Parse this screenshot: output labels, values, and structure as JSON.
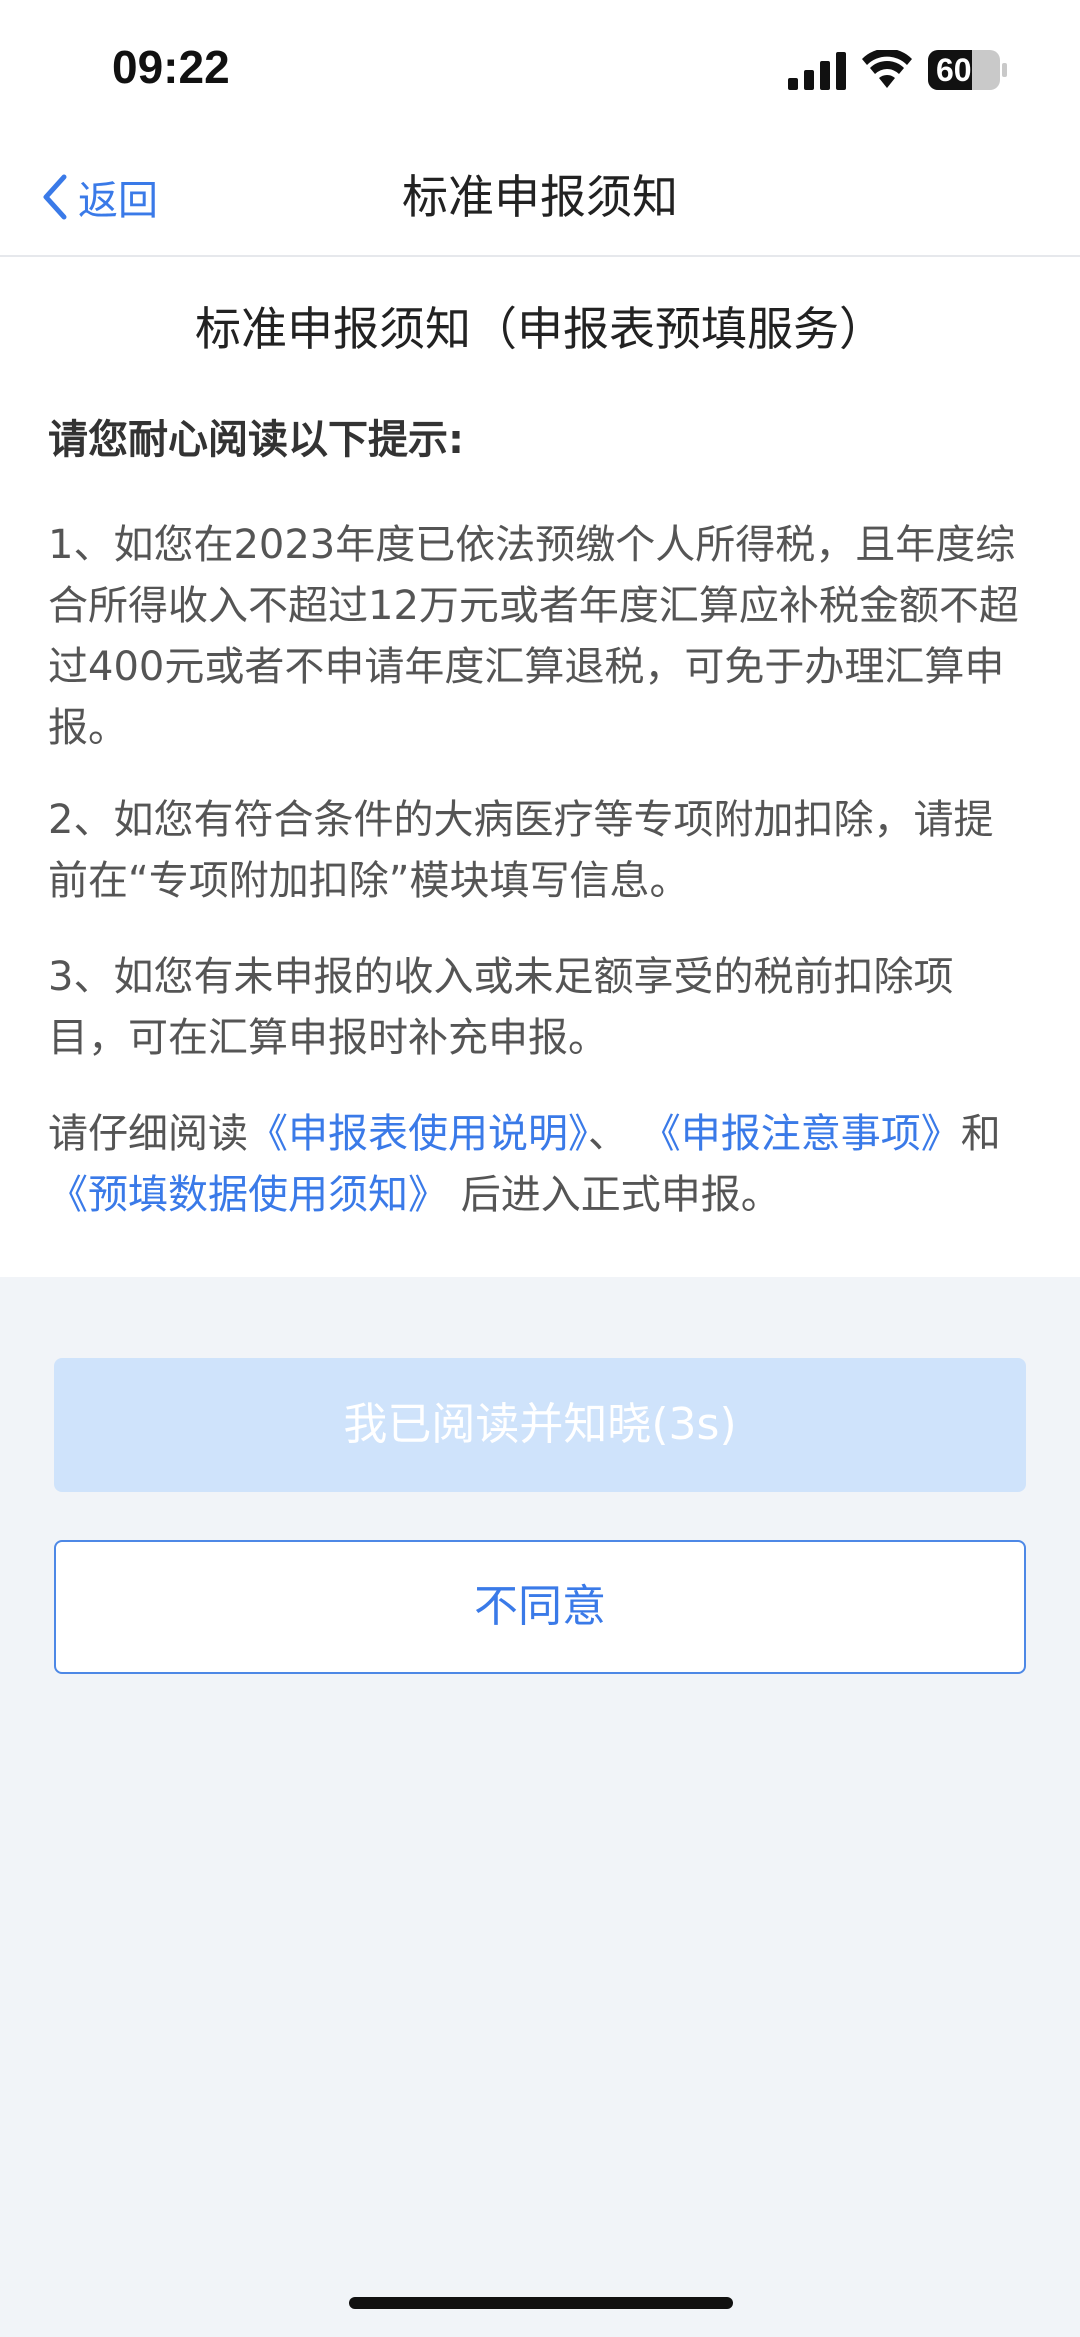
{
  "status_bar": {
    "time": "09:22",
    "battery": "60",
    "icons": [
      "signal-icon",
      "wifi-icon",
      "battery-icon"
    ]
  },
  "nav": {
    "back_label": "返回",
    "title": "标准申报须知"
  },
  "content": {
    "doc_title": "标准申报须知（申报表预填服务）",
    "prompt_heading": "请您耐心阅读以下提示:",
    "notices": [
      "1、如您在2023年度已依法预缴个人所得税，且年度综合所得收入不超过12万元或者年度汇算应补税金额不超过400元或者不申请年度汇算退税，可免于办理汇算申报。",
      "2、如您有符合条件的大病医疗等专项附加扣除，请提前在“专项附加扣除”模块填写信息。",
      "3、如您有未申报的收入或未足额享受的税前扣除项目，可在汇算申报时补充申报。"
    ],
    "reading": {
      "prefix": "请仔细阅读",
      "link1": "《申报表使用说明》",
      "sep1": "、",
      "link2": "《申报注意事项》",
      "and": "和",
      "link3": "《预填数据使用须知》",
      "suffix": "后进入正式申报。"
    }
  },
  "actions": {
    "agree_label": "我已阅读并知晓(3s)",
    "disagree_label": "不同意"
  },
  "colors": {
    "accent": "#3a7ae8",
    "disabled_button": "#cfe3fb",
    "page_background": "#f1f4f8"
  }
}
